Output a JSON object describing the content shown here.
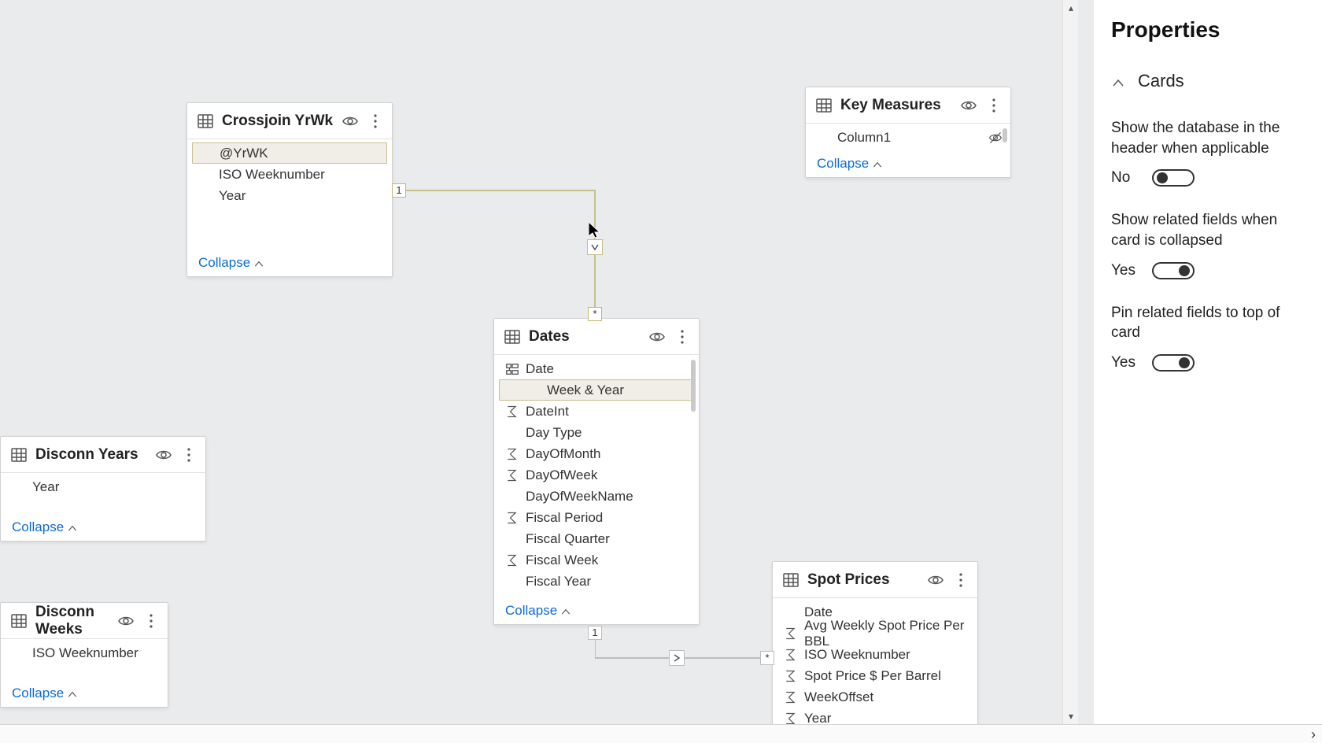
{
  "properties": {
    "title": "Properties",
    "section": "Cards",
    "items": [
      {
        "label": "Show the database in the header when applicable",
        "value": "No",
        "on": false
      },
      {
        "label": "Show related fields when card is collapsed",
        "value": "Yes",
        "on": true
      },
      {
        "label": "Pin related fields to top of card",
        "value": "Yes",
        "on": true
      }
    ]
  },
  "collapse_label": "Collapse",
  "tables": {
    "crossjoin": {
      "title": "Crossjoin YrWk",
      "fields": [
        {
          "name": "@YrWK",
          "icon": "blank",
          "selected": true
        },
        {
          "name": "ISO Weeknumber",
          "icon": "blank"
        },
        {
          "name": "Year",
          "icon": "blank"
        }
      ]
    },
    "keymeasures": {
      "title": "Key Measures",
      "fields": [
        {
          "name": "Column1",
          "icon": "blank",
          "hidden": true
        }
      ]
    },
    "dates": {
      "title": "Dates",
      "fields": [
        {
          "name": "Date",
          "icon": "hierarchy"
        },
        {
          "name": "Week & Year",
          "icon": "blank",
          "indent": true,
          "selected": true
        },
        {
          "name": "DateInt",
          "icon": "sigma"
        },
        {
          "name": "Day Type",
          "icon": "blank"
        },
        {
          "name": "DayOfMonth",
          "icon": "sigma"
        },
        {
          "name": "DayOfWeek",
          "icon": "sigma"
        },
        {
          "name": "DayOfWeekName",
          "icon": "blank"
        },
        {
          "name": "Fiscal Period",
          "icon": "sigma"
        },
        {
          "name": "Fiscal Quarter",
          "icon": "blank"
        },
        {
          "name": "Fiscal Week",
          "icon": "sigma"
        },
        {
          "name": "Fiscal Year",
          "icon": "blank"
        }
      ]
    },
    "disconn_years": {
      "title": "Disconn Years",
      "fields": [
        {
          "name": "Year",
          "icon": "blank"
        }
      ]
    },
    "disconn_weeks": {
      "title": "Disconn Weeks",
      "fields": [
        {
          "name": "ISO Weeknumber",
          "icon": "blank"
        }
      ]
    },
    "spot_prices": {
      "title": "Spot Prices",
      "fields": [
        {
          "name": "Date",
          "icon": "blank"
        },
        {
          "name": "Avg Weekly Spot Price Per BBL",
          "icon": "sigma"
        },
        {
          "name": "ISO Weeknumber",
          "icon": "sigma"
        },
        {
          "name": "Spot Price $ Per Barrel",
          "icon": "sigma"
        },
        {
          "name": "WeekOffset",
          "icon": "sigma"
        },
        {
          "name": "Year",
          "icon": "sigma"
        }
      ]
    }
  },
  "relationships": {
    "crossjoin_dates": {
      "from_card": "1",
      "to_card": "*"
    },
    "dates_spot": {
      "from_card": "1",
      "to_card": "*"
    }
  }
}
